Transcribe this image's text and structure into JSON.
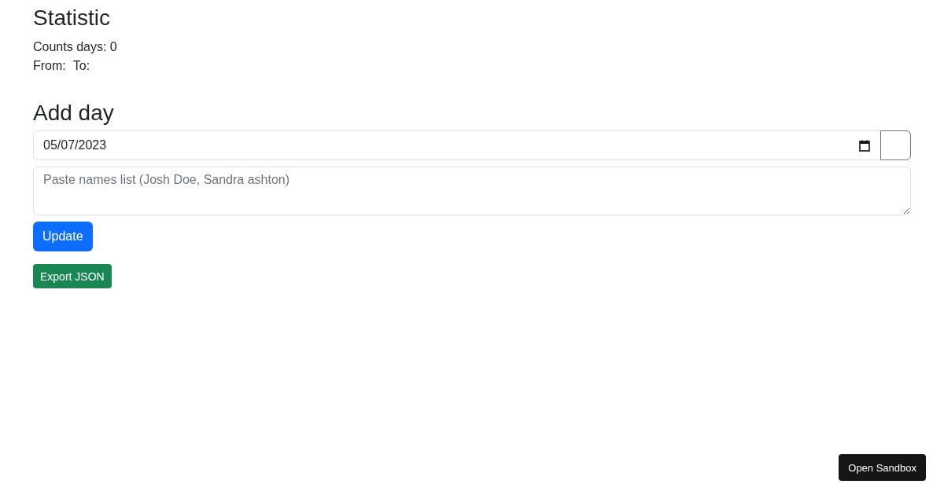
{
  "statistic": {
    "title": "Statistic",
    "counts_days": "Counts days: 0",
    "from": "From:",
    "to": "To:"
  },
  "add_day": {
    "title": "Add day",
    "date": {
      "value": "05/07/2023"
    },
    "names": {
      "placeholder": "Paste names list (Josh Doe, Sandra ashton)"
    },
    "update_button": "Update",
    "export_button": "Export JSON"
  },
  "sandbox_button": "Open Sandbox"
}
